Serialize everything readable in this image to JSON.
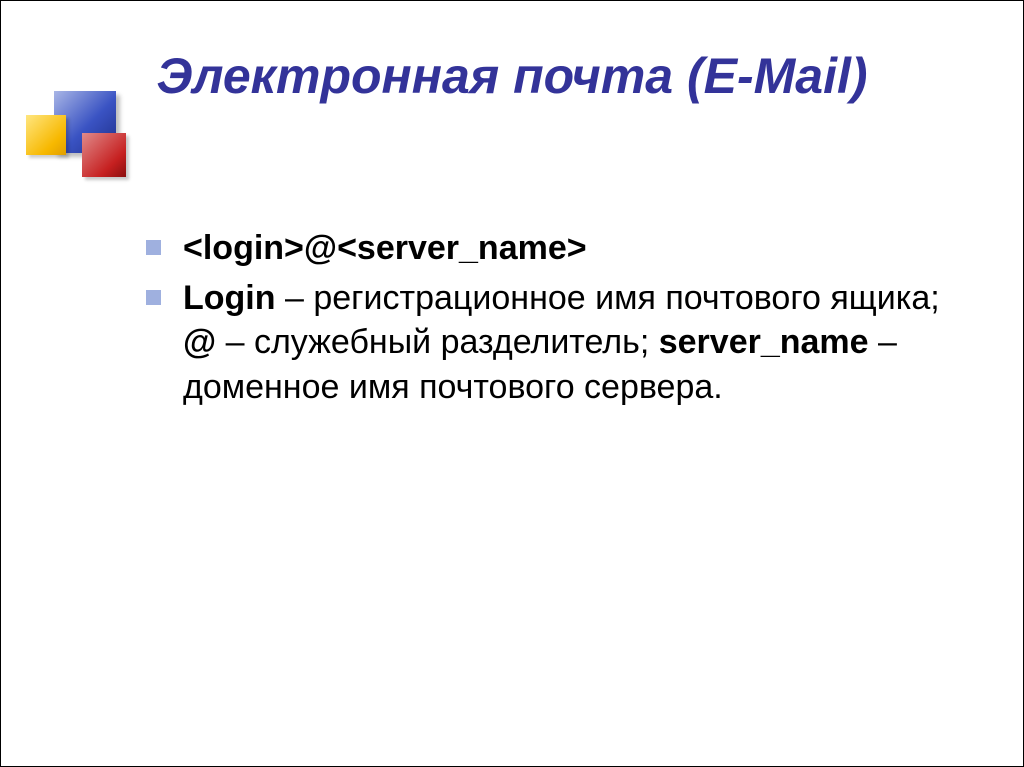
{
  "title": "Электронная почта (E-Mail)",
  "bullets": [
    {
      "runs": [
        {
          "text": "<login>@<server_name>",
          "bold": true
        }
      ]
    },
    {
      "runs": [
        {
          "text": "Login",
          "bold": true
        },
        {
          "text": " – регистрационное имя почтового ящика; ",
          "bold": false
        },
        {
          "text": "@",
          "bold": true
        },
        {
          "text": " – служебный разделитель; ",
          "bold": false
        },
        {
          "text": "server_name",
          "bold": true
        },
        {
          "text": " – доменное имя почтового сервера.",
          "bold": false
        }
      ]
    }
  ]
}
